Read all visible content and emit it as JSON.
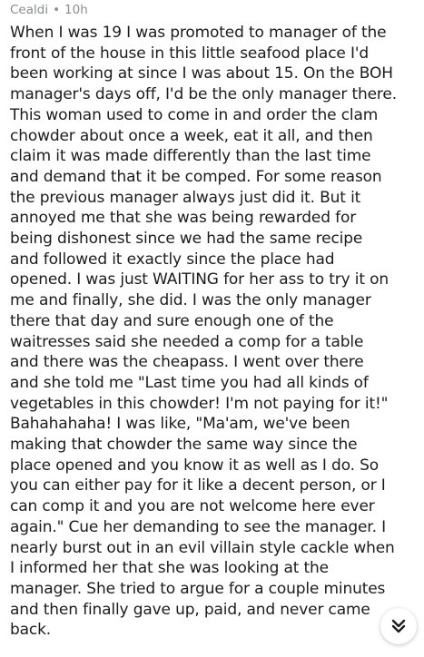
{
  "comment": {
    "author": "Cealdi",
    "separator": "•",
    "age": "10h",
    "lines": [
      "When I was 19 I was promoted to manager of the",
      "front of the house in this little seafood place I'd",
      "been working at since I was about 15. On the BOH",
      "manager's days off, I'd be the only manager there.",
      "This woman used to come in and order the clam",
      "chowder about once a week, eat it all, and then",
      "claim it was made differently than the last time",
      "and demand that it be comped. For some reason",
      "the previous manager always just did it. But it",
      "annoyed me that she was being rewarded for",
      "being dishonest since we had the same recipe",
      "and followed it exactly since the place had",
      "opened. I was just WAITING for her ass to try it on",
      "me and finally, she did. I was the only manager",
      "there that day and sure enough one of the",
      "waitresses said she needed a comp for a table",
      "and there was the cheapass. I went over there",
      "and she told me \"Last time you had all kinds of",
      "vegetables in this chowder! I'm not paying for it!\"",
      "Bahahahaha! I was like, \"Ma'am, we've been",
      "making that chowder the same way since the",
      "place opened and you know it as well as I do. So",
      "you can either pay for it like a decent person, or I",
      "can comp it and you are not welcome here ever",
      "again.\" Cue her demanding to see the manager. I",
      "nearly burst out in an evil villain style cackle when",
      "I informed her that she was looking at the",
      "manager. She tried to argue for a couple minutes",
      "and then finally gave up, paid, and never came",
      "back."
    ]
  },
  "scroll_button": {
    "icon": "double-chevron-down-icon",
    "icon_color": "#1c1c1c"
  },
  "colors": {
    "meta_text": "#8a8c8f",
    "body_text": "#1c1c1c",
    "background": "#ffffff"
  }
}
